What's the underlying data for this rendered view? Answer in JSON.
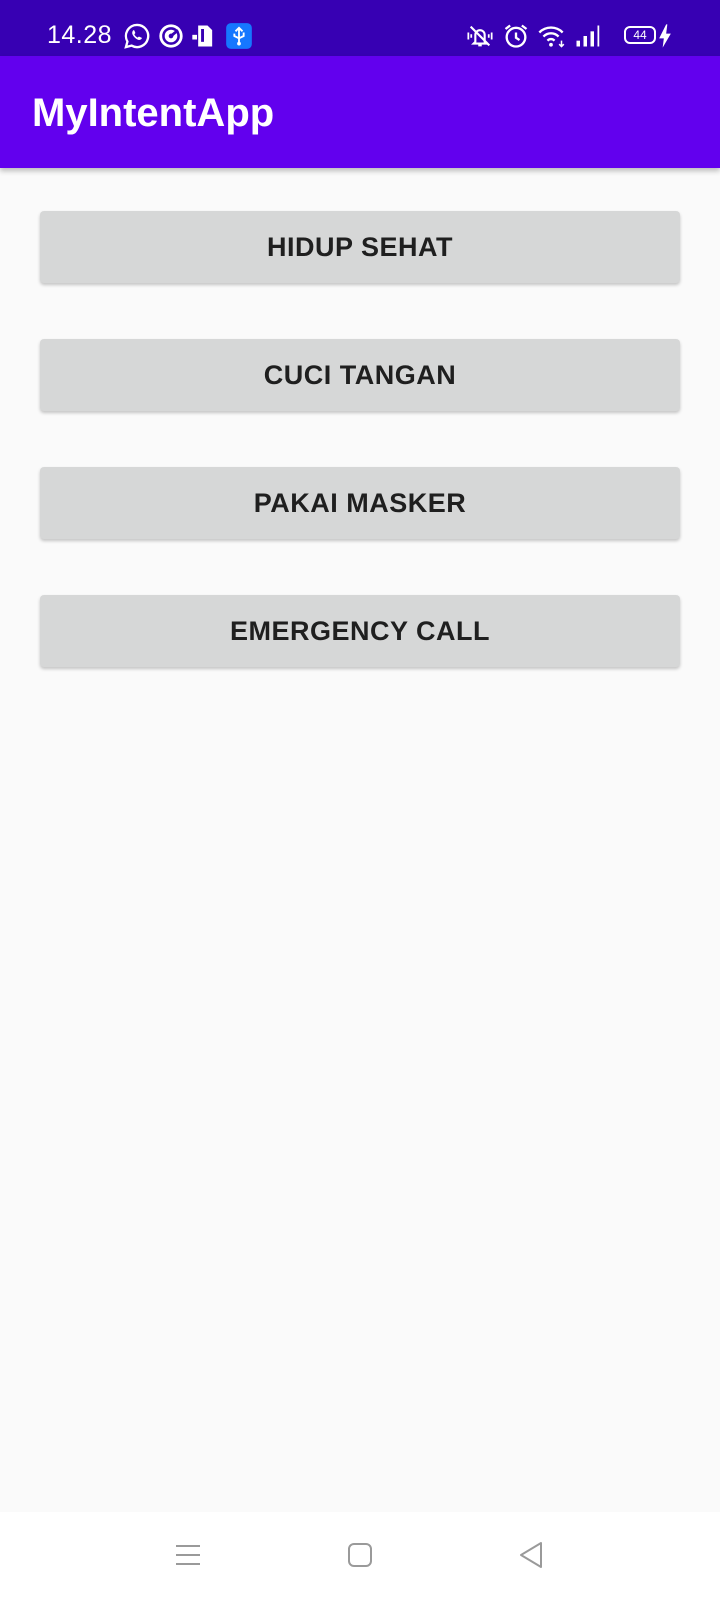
{
  "status_bar": {
    "time": "14.28",
    "battery_level": "44",
    "icons": [
      "whatsapp-icon",
      "messenger-icon",
      "sim-card-icon",
      "usb-icon",
      "vibrate-silent-icon",
      "alarm-icon",
      "wifi-icon",
      "signal-icon",
      "battery-icon",
      "charging-icon"
    ]
  },
  "app_bar": {
    "title": "MyIntentApp"
  },
  "buttons": [
    {
      "label": "HIDUP SEHAT"
    },
    {
      "label": "CUCI TANGAN"
    },
    {
      "label": "PAKAI MASKER"
    },
    {
      "label": "EMERGENCY CALL"
    }
  ],
  "nav_bar": {
    "icons": [
      "menu-icon",
      "home-icon",
      "back-icon"
    ]
  },
  "colors": {
    "status_bar": "#3700b3",
    "app_bar": "#6200ee",
    "background": "#fafafa",
    "button": "#d6d7d7",
    "button_text": "#1f1f1f",
    "usb_badge": "#1677ff"
  }
}
